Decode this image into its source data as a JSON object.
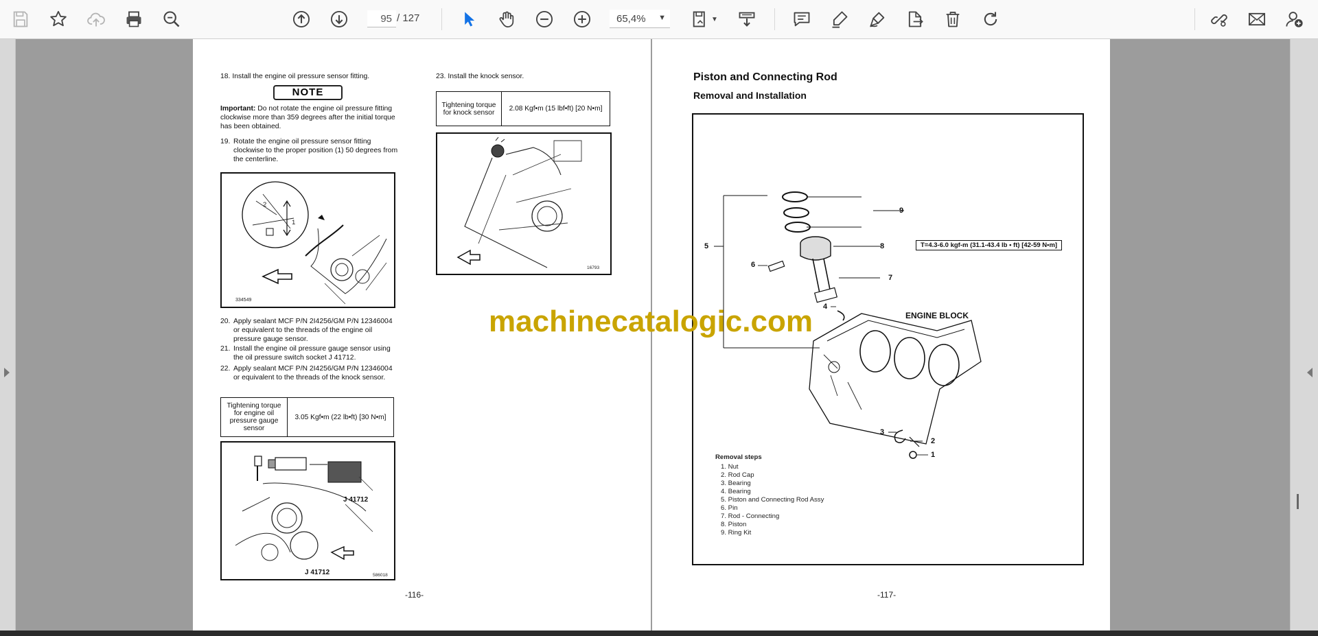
{
  "toolbar": {
    "icons": [
      "save-icon",
      "bookmark-star-icon",
      "upload-cloud-icon",
      "print-icon",
      "zoom-search-icon",
      "page-up-icon",
      "page-down-icon",
      "select-arrow-icon",
      "hand-icon",
      "zoom-out-icon",
      "zoom-in-icon",
      "fit-page-icon",
      "scroll-mode-icon",
      "comment-icon",
      "highlight-pen-icon",
      "sign-icon",
      "export-icon",
      "delete-icon",
      "rotate-icon",
      "share-link-icon",
      "mail-icon",
      "add-user-icon"
    ],
    "current_page": "95",
    "page_total": "/ 127",
    "zoom": "65,4%"
  },
  "colors": {
    "accent": "#1473e6",
    "watermark": "#c9a400"
  },
  "left_page": {
    "step18": "18. Install the engine oil pressure sensor fitting.",
    "note_label": "NOTE",
    "important_label": "Important:",
    "important_text": "Do not rotate the engine oil pressure fitting clockwise more than 359 degrees after the initial torque has been obtained.",
    "step19_num": "19.",
    "step19": "Rotate the engine oil pressure sensor fitting clockwise to the proper position (1) 50 degrees from the centerline.",
    "fig1_callout_2": "2",
    "fig1_callout_1": "1",
    "fig1_code": "334549",
    "step20_num": "20.",
    "step20": "Apply sealant MCF P/N 2I4256/GM P/N 12346004 or equivalent to the threads of the engine oil pressure gauge sensor.",
    "step21_num": "21.",
    "step21": "Install the engine oil pressure gauge sensor using the oil pressure switch socket J 41712.",
    "step22_num": "22.",
    "step22": "Apply sealant MCF P/N 2I4256/GM P/N 12346004 or equivalent to the threads of the knock sensor.",
    "torque1_label": "Tightening torque for engine oil pressure gauge sensor",
    "torque1_value": "3.05 Kgf•m (22 lb•ft) [30 N•m]",
    "fig2_tool_label": "J 41712",
    "fig2_tool_label_bottom": "J 41712",
    "fig2_code": "586018",
    "step23": "23. Install the knock sensor.",
    "torque2_label": "Tightening torque for knock sensor",
    "torque2_value": "2.08 Kgf•m (15 lbf•ft) [20 N•m]",
    "fig3_code": "16793",
    "page_number": "-116-"
  },
  "right_page": {
    "title": "Piston and Connecting Rod",
    "subtitle": "Removal and Installation",
    "torque_box": "T=4.3-6.0 kgf-m (31.1-43.4 lb • ft) [42-59 N•m]",
    "engine_block_label": "ENGINE BLOCK",
    "callouts": [
      "9",
      "8",
      "7",
      "6",
      "5",
      "4",
      "3",
      "2",
      "1"
    ],
    "removal_title": "Removal steps",
    "removal_steps": [
      "1. Nut",
      "2. Rod Cap",
      "3. Bearing",
      "4. Bearing",
      "5. Piston and Connecting Rod Assy",
      "6. Pin",
      "7. Rod - Connecting",
      "8. Piston",
      "9. Ring Kit"
    ],
    "page_number": "-117-"
  },
  "watermark": "machinecatalogic.com"
}
